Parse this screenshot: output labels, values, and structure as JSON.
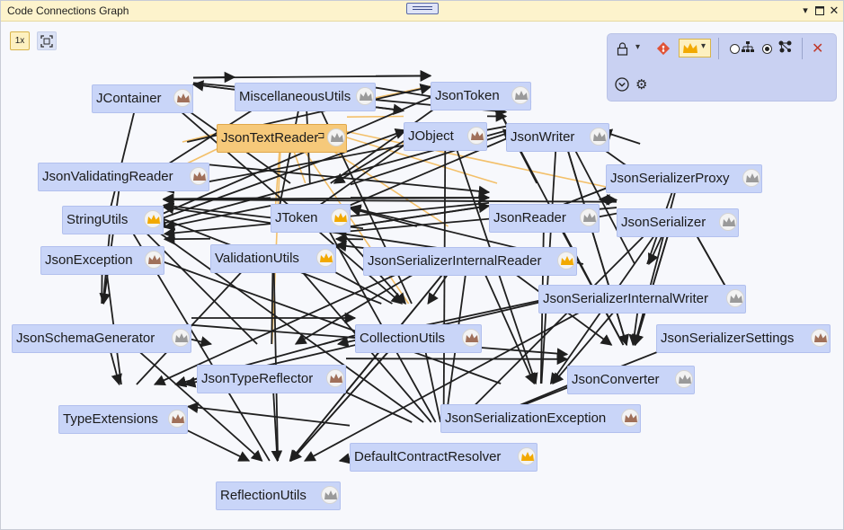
{
  "window": {
    "title": "Code Connections Graph"
  },
  "toolbar": {
    "zoom_label": "1x"
  },
  "colors": {
    "gold": "#f2a900",
    "bronze": "#a0705a",
    "silver": "#9a9a9a",
    "close": "#c0392b",
    "git": "#e05236"
  },
  "nodes": [
    {
      "id": "JContainer",
      "label": "JContainer",
      "crown": "bronze"
    },
    {
      "id": "MiscellaneousUtils",
      "label": "MiscellaneousUtils",
      "crown": "silver"
    },
    {
      "id": "JsonToken",
      "label": "JsonToken",
      "crown": "silver"
    },
    {
      "id": "JsonTextReader",
      "label": "JsonTextReader",
      "crown": "silver"
    },
    {
      "id": "JObject",
      "label": "JObject",
      "crown": "bronze"
    },
    {
      "id": "JsonWriter",
      "label": "JsonWriter",
      "crown": "silver"
    },
    {
      "id": "JsonValidatingReader",
      "label": "JsonValidatingReader",
      "crown": "bronze"
    },
    {
      "id": "JsonSerializerProxy",
      "label": "JsonSerializerProxy",
      "crown": "silver"
    },
    {
      "id": "StringUtils",
      "label": "StringUtils",
      "crown": "gold"
    },
    {
      "id": "JToken",
      "label": "JToken",
      "crown": "gold"
    },
    {
      "id": "JsonReader",
      "label": "JsonReader",
      "crown": "silver"
    },
    {
      "id": "JsonSerializer",
      "label": "JsonSerializer",
      "crown": "silver"
    },
    {
      "id": "JsonException",
      "label": "JsonException",
      "crown": "bronze"
    },
    {
      "id": "ValidationUtils",
      "label": "ValidationUtils",
      "crown": "gold"
    },
    {
      "id": "JsonSerializerInternalReader",
      "label": "JsonSerializerInternalReader",
      "crown": "gold"
    },
    {
      "id": "JsonSerializerInternalWriter",
      "label": "JsonSerializerInternalWriter",
      "crown": "silver"
    },
    {
      "id": "JsonSchemaGenerator",
      "label": "JsonSchemaGenerator",
      "crown": "silver"
    },
    {
      "id": "CollectionUtils",
      "label": "CollectionUtils",
      "crown": "bronze"
    },
    {
      "id": "JsonSerializerSettings",
      "label": "JsonSerializerSettings",
      "crown": "bronze"
    },
    {
      "id": "JsonTypeReflector",
      "label": "JsonTypeReflector",
      "crown": "bronze"
    },
    {
      "id": "JsonConverter",
      "label": "JsonConverter",
      "crown": "silver"
    },
    {
      "id": "TypeExtensions",
      "label": "TypeExtensions",
      "crown": "bronze"
    },
    {
      "id": "JsonSerializationException",
      "label": "JsonSerializationException",
      "crown": "bronze"
    },
    {
      "id": "DefaultContractResolver",
      "label": "DefaultContractResolver",
      "crown": "gold"
    },
    {
      "id": "ReflectionUtils",
      "label": "ReflectionUtils",
      "crown": "silver"
    }
  ],
  "selected_node": "JsonTextReader",
  "edges": [
    [
      "JsonTextReader",
      "JsonToken"
    ],
    [
      "JsonTextReader",
      "StringUtils"
    ],
    [
      "JsonTextReader",
      "JToken"
    ],
    [
      "JsonTextReader",
      "JsonSerializerInternalReader"
    ],
    [
      "JsonTextReader",
      "CollectionUtils"
    ],
    [
      "JsonTextReader",
      "JsonReader"
    ],
    [
      "JsonTextReader",
      "JsonSerializer"
    ],
    [
      "JsonTextReader",
      "JObject"
    ],
    [
      "JsonTextReader",
      "JsonValidatingReader"
    ],
    [
      "JsonTextReader",
      "ValidationUtils"
    ],
    [
      "JsonTypeReflector",
      "JsonTextReader"
    ],
    [
      "JContainer",
      "MiscellaneousUtils"
    ],
    [
      "JContainer",
      "JsonToken"
    ],
    [
      "JContainer",
      "JObject"
    ],
    [
      "JContainer",
      "StringUtils"
    ],
    [
      "JContainer",
      "CollectionUtils"
    ],
    [
      "JContainer",
      "JsonWriter"
    ],
    [
      "JObject",
      "JsonToken"
    ],
    [
      "JObject",
      "JsonWriter"
    ],
    [
      "JObject",
      "JContainer"
    ],
    [
      "JObject",
      "JToken"
    ],
    [
      "JObject",
      "ValidationUtils"
    ],
    [
      "JObject",
      "JsonSerializationException"
    ],
    [
      "JsonWriter",
      "JsonToken"
    ],
    [
      "JsonWriter",
      "StringUtils"
    ],
    [
      "JsonWriter",
      "JsonException"
    ],
    [
      "JsonWriter",
      "ValidationUtils"
    ],
    [
      "JsonWriter",
      "JsonConverter"
    ],
    [
      "JsonValidatingReader",
      "JsonReader"
    ],
    [
      "JsonValidatingReader",
      "StringUtils"
    ],
    [
      "JsonValidatingReader",
      "JsonException"
    ],
    [
      "JsonValidatingReader",
      "JsonToken"
    ],
    [
      "JsonValidatingReader",
      "JsonSchemaGenerator"
    ],
    [
      "JsonSerializerProxy",
      "JsonSerializer"
    ],
    [
      "JsonSerializerProxy",
      "JsonWriter"
    ],
    [
      "JsonSerializerProxy",
      "JsonSerializerInternalReader"
    ],
    [
      "JsonSerializerProxy",
      "JsonConverter"
    ],
    [
      "JToken",
      "StringUtils"
    ],
    [
      "JToken",
      "JsonToken"
    ],
    [
      "JToken",
      "JsonReader"
    ],
    [
      "JToken",
      "JsonWriter"
    ],
    [
      "JToken",
      "MiscellaneousUtils"
    ],
    [
      "JToken",
      "JsonException"
    ],
    [
      "JToken",
      "ValidationUtils"
    ],
    [
      "JToken",
      "CollectionUtils"
    ],
    [
      "JToken",
      "JContainer"
    ],
    [
      "JsonReader",
      "JsonToken"
    ],
    [
      "JsonReader",
      "StringUtils"
    ],
    [
      "JsonReader",
      "JsonException"
    ],
    [
      "JsonReader",
      "ValidationUtils"
    ],
    [
      "JsonReader",
      "JsonSerializer"
    ],
    [
      "JsonSerializer",
      "JsonReader"
    ],
    [
      "JsonSerializer",
      "JsonWriter"
    ],
    [
      "JsonSerializer",
      "JsonSerializerInternalReader"
    ],
    [
      "JsonSerializer",
      "JsonSerializerInternalWriter"
    ],
    [
      "JsonSerializer",
      "JsonConverter"
    ],
    [
      "JsonSerializer",
      "JsonSerializerSettings"
    ],
    [
      "JsonSerializer",
      "JsonSerializationException"
    ],
    [
      "JsonSerializer",
      "DefaultContractResolver"
    ],
    [
      "JsonSerializer",
      "StringUtils"
    ],
    [
      "JsonSerializer",
      "ValidationUtils"
    ],
    [
      "JsonSerializerInternalReader",
      "JToken"
    ],
    [
      "JsonSerializerInternalReader",
      "JsonReader"
    ],
    [
      "JsonSerializerInternalReader",
      "StringUtils"
    ],
    [
      "JsonSerializerInternalReader",
      "ValidationUtils"
    ],
    [
      "JsonSerializerInternalReader",
      "CollectionUtils"
    ],
    [
      "JsonSerializerInternalReader",
      "JsonTypeReflector"
    ],
    [
      "JsonSerializerInternalReader",
      "ReflectionUtils"
    ],
    [
      "JsonSerializerInternalReader",
      "JsonSerializationException"
    ],
    [
      "JsonSerializerInternalReader",
      "TypeExtensions"
    ],
    [
      "JsonSerializerInternalReader",
      "JsonConverter"
    ],
    [
      "JsonSerializerInternalReader",
      "JsonSerializerProxy"
    ],
    [
      "JsonSerializerInternalWriter",
      "JsonWriter"
    ],
    [
      "JsonSerializerInternalWriter",
      "StringUtils"
    ],
    [
      "JsonSerializerInternalWriter",
      "ValidationUtils"
    ],
    [
      "JsonSerializerInternalWriter",
      "ReflectionUtils"
    ],
    [
      "JsonSerializerInternalWriter",
      "TypeExtensions"
    ],
    [
      "JsonSerializerInternalWriter",
      "JsonTypeReflector"
    ],
    [
      "JsonSerializerInternalWriter",
      "JsonSerializationException"
    ],
    [
      "JsonSerializerInternalWriter",
      "JsonConverter"
    ],
    [
      "JsonSerializerInternalWriter",
      "JsonSerializerProxy"
    ],
    [
      "JsonSerializerInternalWriter",
      "JToken"
    ],
    [
      "JsonSchemaGenerator",
      "JsonTypeReflector"
    ],
    [
      "JsonSchemaGenerator",
      "TypeExtensions"
    ],
    [
      "JsonSchemaGenerator",
      "ReflectionUtils"
    ],
    [
      "JsonSchemaGenerator",
      "CollectionUtils"
    ],
    [
      "JsonSchemaGenerator",
      "StringUtils"
    ],
    [
      "JsonSchemaGenerator",
      "JsonException"
    ],
    [
      "JsonSchemaGenerator",
      "JsonConverter"
    ],
    [
      "JsonSerializerSettings",
      "JsonSerializer"
    ],
    [
      "JsonSerializerSettings",
      "JsonConverter"
    ],
    [
      "CollectionUtils",
      "ValidationUtils"
    ],
    [
      "CollectionUtils",
      "ReflectionUtils"
    ],
    [
      "CollectionUtils",
      "TypeExtensions"
    ],
    [
      "CollectionUtils",
      "StringUtils"
    ],
    [
      "CollectionUtils",
      "MiscellaneousUtils"
    ],
    [
      "JsonTypeReflector",
      "ReflectionUtils"
    ],
    [
      "JsonTypeReflector",
      "TypeExtensions"
    ],
    [
      "JsonTypeReflector",
      "JsonConverter"
    ],
    [
      "JsonTypeReflector",
      "ValidationUtils"
    ],
    [
      "JsonTypeReflector",
      "StringUtils"
    ],
    [
      "JsonTypeReflector",
      "CollectionUtils"
    ],
    [
      "JsonConverter",
      "JsonReader"
    ],
    [
      "JsonConverter",
      "JsonWriter"
    ],
    [
      "JsonConverter",
      "JsonSerializer"
    ],
    [
      "JsonConverter",
      "JsonToken"
    ],
    [
      "JsonSerializationException",
      "JsonException"
    ],
    [
      "JsonSerializationException",
      "JsonReader"
    ],
    [
      "JsonSerializationException",
      "JsonWriter"
    ],
    [
      "DefaultContractResolver",
      "ReflectionUtils"
    ],
    [
      "DefaultContractResolver",
      "TypeExtensions"
    ],
    [
      "DefaultContractResolver",
      "JsonTypeReflector"
    ],
    [
      "DefaultContractResolver",
      "CollectionUtils"
    ],
    [
      "DefaultContractResolver",
      "JsonConverter"
    ],
    [
      "DefaultContractResolver",
      "StringUtils"
    ],
    [
      "DefaultContractResolver",
      "ValidationUtils"
    ],
    [
      "DefaultContractResolver",
      "JsonSerializerSettings"
    ],
    [
      "DefaultContractResolver",
      "JToken"
    ],
    [
      "DefaultContractResolver",
      "JObject"
    ],
    [
      "DefaultContractResolver",
      "JsonSerializationException"
    ],
    [
      "DefaultContractResolver",
      "JsonSerializerInternalReader"
    ],
    [
      "TypeExtensions",
      "ReflectionUtils"
    ],
    [
      "TypeExtensions",
      "ValidationUtils"
    ],
    [
      "TypeExtensions",
      "JsonException"
    ],
    [
      "ReflectionUtils",
      "StringUtils"
    ],
    [
      "ReflectionUtils",
      "ValidationUtils"
    ],
    [
      "ReflectionUtils",
      "CollectionUtils"
    ],
    [
      "ReflectionUtils",
      "JsonSerializerInternalReader"
    ],
    [
      "ValidationUtils",
      "MiscellaneousUtils"
    ],
    [
      "ValidationUtils",
      "JsonException"
    ],
    [
      "ValidationUtils",
      "JsonReader"
    ],
    [
      "StringUtils",
      "MiscellaneousUtils"
    ],
    [
      "JsonException",
      "JsonToken"
    ],
    [
      "JsonException",
      "JObject"
    ],
    [
      "MiscellaneousUtils",
      "JsonToken"
    ],
    [
      "MiscellaneousUtils",
      "JsonWriter"
    ]
  ]
}
